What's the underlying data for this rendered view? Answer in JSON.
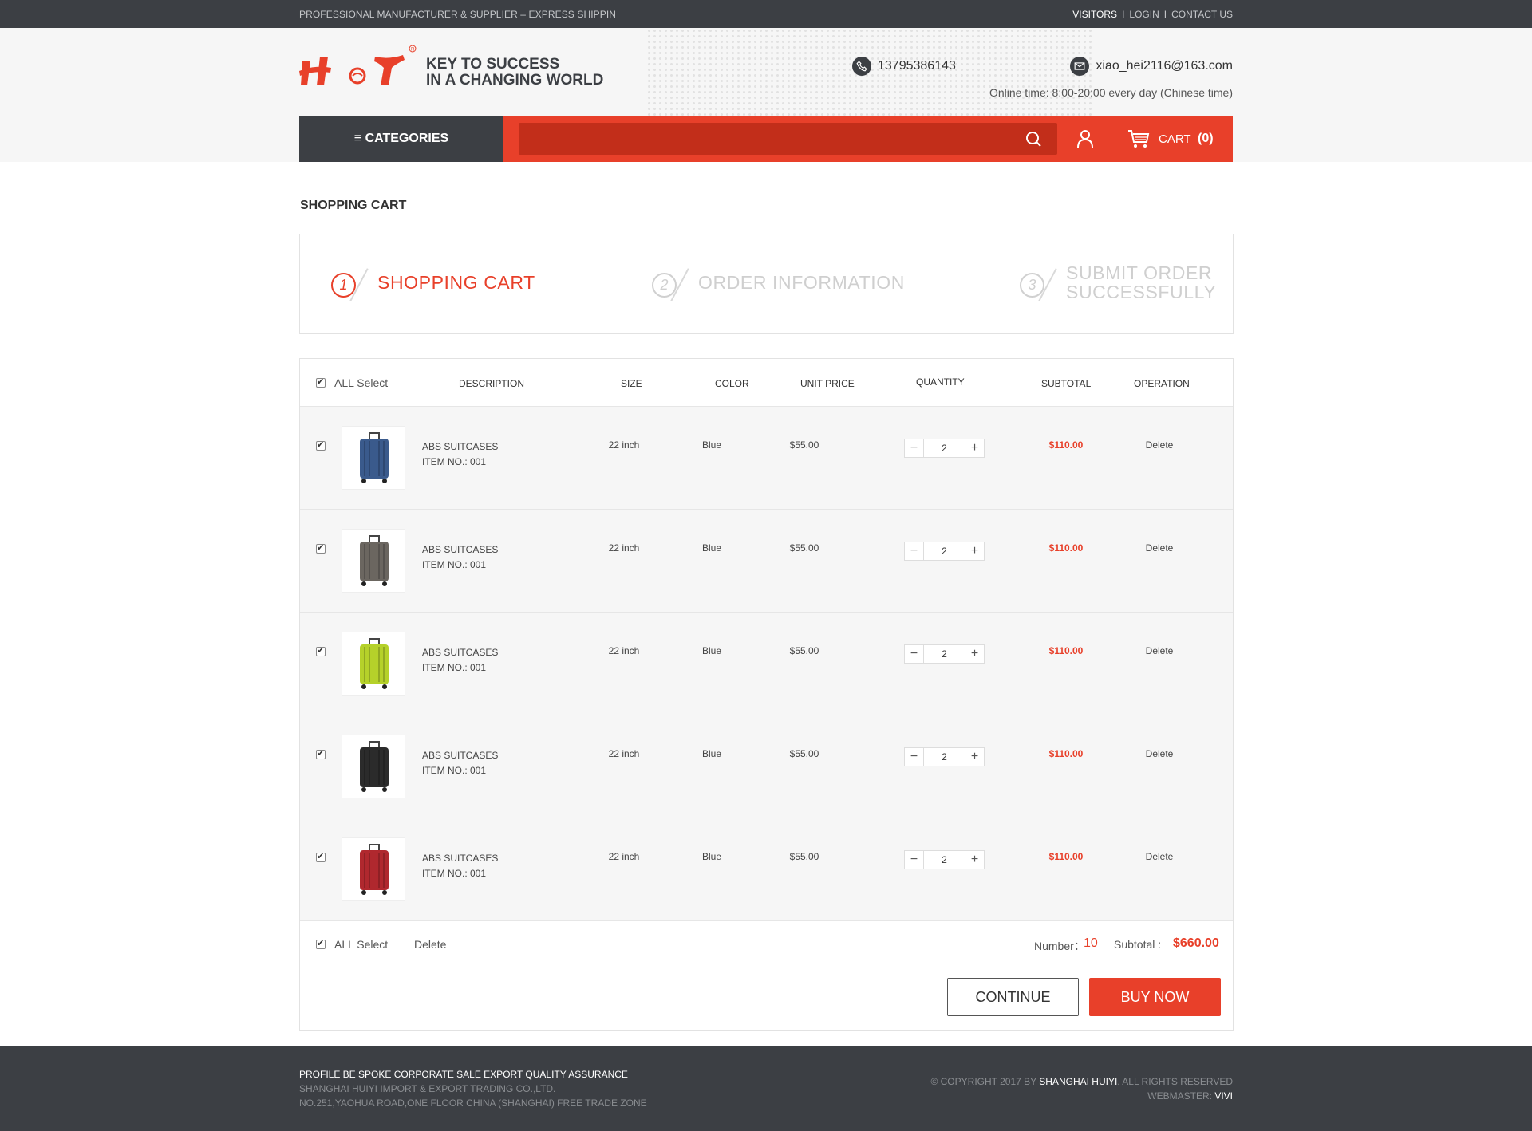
{
  "topbar": {
    "tagline": "PROFESSIONAL MANUFACTURER & SUPPLIER – EXPRESS SHIPPIN",
    "links": [
      "VISITORS",
      "LOGIN",
      "CONTACT US"
    ]
  },
  "header": {
    "slogan_line1": "KEY TO SUCCESS",
    "slogan_line2": "IN A CHANGING WORLD",
    "phone": "13795386143",
    "email": "xiao_hei2116@163.com",
    "online_time": "Online time: 8:00-20:00 every day (Chinese time)"
  },
  "nav": {
    "categories_label": "CATEGORIES",
    "search_placeholder": "",
    "cart_label": "CART",
    "cart_count": "(0)"
  },
  "page_title": "SHOPPING CART",
  "steps": [
    {
      "num": "1",
      "label": "SHOPPING CART"
    },
    {
      "num": "2",
      "label": "ORDER INFORMATION"
    },
    {
      "num": "3",
      "label_line1": "SUBMIT ORDER",
      "label_line2": "SUCCESSFULLY"
    }
  ],
  "table": {
    "all_select": "ALL Select",
    "headers": [
      "DESCRIPTION",
      "SIZE",
      "COLOR",
      "UNIT PRICE",
      "QUANTITY",
      "SUBTOTAL",
      "OPERATION"
    ],
    "rows": [
      {
        "name": "ABS SUITCASES",
        "item_no": "ITEM NO.: 001",
        "size": "22 inch",
        "color": "Blue",
        "price": "$55.00",
        "qty": "2",
        "subtotal": "$110.00",
        "op": "Delete",
        "swatch": "#3a5a8c"
      },
      {
        "name": "ABS SUITCASES",
        "item_no": "ITEM NO.: 001",
        "size": "22 inch",
        "color": "Blue",
        "price": "$55.00",
        "qty": "2",
        "subtotal": "$110.00",
        "op": "Delete",
        "swatch": "#6b6660"
      },
      {
        "name": "ABS SUITCASES",
        "item_no": "ITEM NO.: 001",
        "size": "22 inch",
        "color": "Blue",
        "price": "$55.00",
        "qty": "2",
        "subtotal": "$110.00",
        "op": "Delete",
        "swatch": "#b5d12a"
      },
      {
        "name": "ABS SUITCASES",
        "item_no": "ITEM NO.: 001",
        "size": "22 inch",
        "color": "Blue",
        "price": "$55.00",
        "qty": "2",
        "subtotal": "$110.00",
        "op": "Delete",
        "swatch": "#2b2b2b"
      },
      {
        "name": "ABS SUITCASES",
        "item_no": "ITEM NO.: 001",
        "size": "22 inch",
        "color": "Blue",
        "price": "$55.00",
        "qty": "2",
        "subtotal": "$110.00",
        "op": "Delete",
        "swatch": "#b0282e"
      }
    ],
    "minus": "−",
    "plus": "+"
  },
  "summary": {
    "all_select": "ALL Select",
    "delete": "Delete",
    "number_label": "Number：",
    "number_value": "10",
    "subtotal_label": "Subtotal :",
    "subtotal_value": "$660.00",
    "continue_label": "CONTINUE",
    "buy_label": "BUY NOW"
  },
  "footer": {
    "line1": "PROFILE BE SPOKE CORPORATE SALE EXPORT QUALITY ASSURANCE",
    "line2": "SHANGHAI HUIYI IMPORT & EXPORT  TRADING CO.,LTD.",
    "line3": "NO.251,YAOHUA ROAD,ONE FLOOR  CHINA (SHANGHAI) FREE TRADE ZONE",
    "copyright_prefix": "© COPYRIGHT 2017 BY",
    "copyright_company": "SHANGHAI HUIYI",
    "copyright_suffix": ". ALL RIGHTS RESERVED",
    "webmaster_label": "WEBMASTER:",
    "webmaster_name": "VIVI"
  },
  "colors": {
    "accent": "#e8402a",
    "dark": "#3c3f44",
    "search_bg": "#c22e1a"
  }
}
